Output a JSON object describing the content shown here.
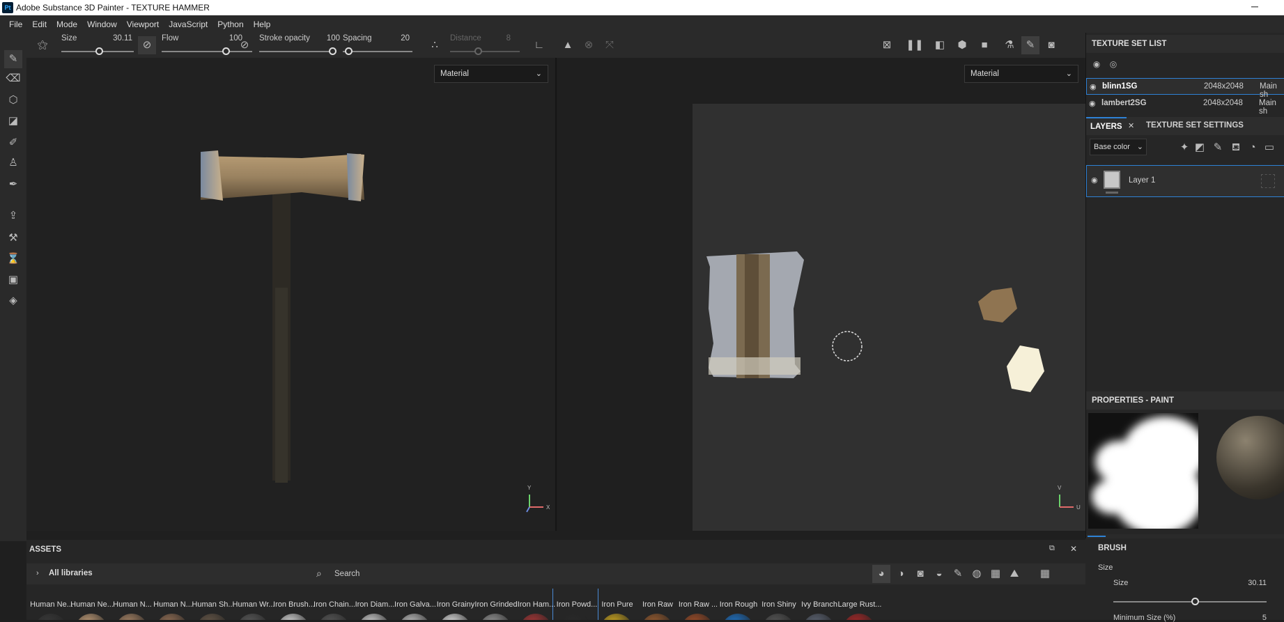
{
  "app": {
    "title": "Adobe Substance 3D Painter - TEXTURE HAMMER",
    "logo": "Pt",
    "minimize": "─"
  },
  "menu": [
    "File",
    "Edit",
    "Mode",
    "Window",
    "Viewport",
    "JavaScript",
    "Python",
    "Help"
  ],
  "toolbar": {
    "size_label": "Size",
    "size_value": "30.11",
    "flow_label": "Flow",
    "flow_value": "100",
    "opacity_label": "Stroke opacity",
    "opacity_value": "100",
    "spacing_label": "Spacing",
    "spacing_value": "20",
    "distance_label": "Distance",
    "distance_value": "8"
  },
  "viewport": {
    "left_mode": "Material",
    "right_mode": "Material",
    "axis_y": "Y",
    "axis_x": "X",
    "axis_v": "V",
    "axis_u": "U"
  },
  "texture_set_list": {
    "title": "TEXTURE SET LIST",
    "sets": [
      {
        "name": "blinn1SG",
        "res": "2048x2048",
        "shader": "Main sh"
      },
      {
        "name": "lambert2SG",
        "res": "2048x2048",
        "shader": "Main sh"
      }
    ]
  },
  "layers": {
    "tab_layers": "LAYERS",
    "tab_close": "✕",
    "tab_settings": "TEXTURE SET SETTINGS",
    "channel": "Base color",
    "layer_name": "Layer 1"
  },
  "properties": {
    "title": "PROPERTIES - PAINT",
    "brush_title": "BRUSH",
    "size_group": "Size",
    "size_label": "Size",
    "size_value": "30.11",
    "min_size_label": "Minimum Size (%)",
    "min_size_value": "5"
  },
  "assets": {
    "title": "ASSETS",
    "libraries": "All libraries",
    "search_placeholder": "Search",
    "items": [
      "Human Ne...",
      "Human Ne...",
      "Human N...",
      "Human N...",
      "Human Sh...",
      "Human Wr...",
      "Iron Brush...",
      "Iron Chain...",
      "Iron Diam...",
      "Iron Galva...",
      "Iron Grainy",
      "Iron Grinded",
      "Iron Ham...",
      "Iron Powd...",
      "Iron Pure",
      "Iron Raw",
      "Iron Raw ...",
      "Iron Rough",
      "Iron Shiny",
      "Ivy Branch",
      "Large Rust..."
    ]
  },
  "colors": {
    "accent": "#2e82d6",
    "bg": "#1f1f1f",
    "panel": "#262626"
  }
}
